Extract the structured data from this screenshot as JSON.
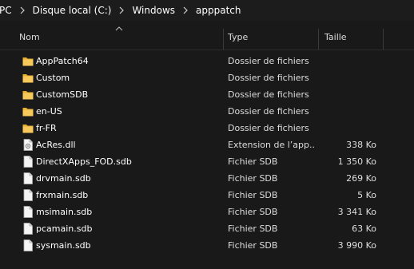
{
  "breadcrumb": {
    "items": [
      "PC",
      "Disque local (C:)",
      "Windows",
      "apppatch"
    ]
  },
  "columns": {
    "name": "Nom",
    "type": "Type",
    "size": "Taille"
  },
  "colors": {
    "background": "#191919",
    "folder": "#f2c14e",
    "text": "#ffffff",
    "secondary_text": "#dedede"
  },
  "files": [
    {
      "name": "AppPatch64",
      "type": "Dossier de fichiers",
      "size": "",
      "icon": "folder-icon"
    },
    {
      "name": "Custom",
      "type": "Dossier de fichiers",
      "size": "",
      "icon": "folder-icon"
    },
    {
      "name": "CustomSDB",
      "type": "Dossier de fichiers",
      "size": "",
      "icon": "folder-icon"
    },
    {
      "name": "en-US",
      "type": "Dossier de fichiers",
      "size": "",
      "icon": "folder-icon"
    },
    {
      "name": "fr-FR",
      "type": "Dossier de fichiers",
      "size": "",
      "icon": "folder-icon"
    },
    {
      "name": "AcRes.dll",
      "type": "Extension de l’app...",
      "size": "338 Ko",
      "icon": "dll-icon"
    },
    {
      "name": "DirectXApps_FOD.sdb",
      "type": "Fichier SDB",
      "size": "1 350 Ko",
      "icon": "file-icon"
    },
    {
      "name": "drvmain.sdb",
      "type": "Fichier SDB",
      "size": "269 Ko",
      "icon": "file-icon"
    },
    {
      "name": "frxmain.sdb",
      "type": "Fichier SDB",
      "size": "5 Ko",
      "icon": "file-icon"
    },
    {
      "name": "msimain.sdb",
      "type": "Fichier SDB",
      "size": "3 341 Ko",
      "icon": "file-icon"
    },
    {
      "name": "pcamain.sdb",
      "type": "Fichier SDB",
      "size": "63 Ko",
      "icon": "file-icon"
    },
    {
      "name": "sysmain.sdb",
      "type": "Fichier SDB",
      "size": "3 990 Ko",
      "icon": "file-icon"
    }
  ]
}
